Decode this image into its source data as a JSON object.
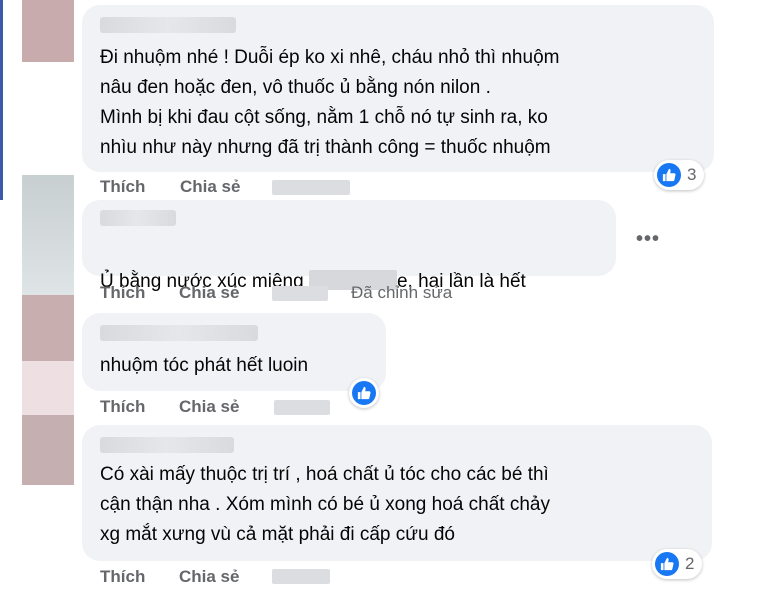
{
  "comments": [
    {
      "text": "Đi nhuộm nhé ! Duỗi ép ko xi nhê, cháu nhỏ thì nhuộm\nnâu đen hoặc đen, vô thuốc ủ bằng nón nilon .\nMình bị khi đau cột sống, nằm 1 chỗ nó tự sinh ra, ko\nnhìu như này nhưng đã trị thành công = thuốc nhuộm",
      "like": "Thích",
      "share": "Chia sẻ",
      "reaction_count": "3"
    },
    {
      "text_before": "Ủ bằng nước xúc miệng ",
      "text_after": "e, hai lần là hết",
      "like": "Thích",
      "share": "Chia sẻ",
      "edited": "Đã chỉnh sửa",
      "more": "•••"
    },
    {
      "text": "nhuộm tóc phát hết luoin",
      "like": "Thích",
      "share": "Chia sẻ"
    },
    {
      "text": "Có xài mấy thuộc trị trí , hoá chất ủ tóc cho các bé thì\ncận thận nha . Xóm mình có bé ủ xong hoá chất chảy\nxg mắt xưng vù cả mặt phải đi cấp cứu đó",
      "like": "Thích",
      "share": "Chia sẻ",
      "reaction_count": "2"
    }
  ],
  "icons": {
    "like": "like-thumb-icon",
    "more": "more-horizontal-icon"
  },
  "colors": {
    "bubble": "#f0f2f5",
    "like_blue": "#1877f2",
    "meta_gray": "#65676b"
  }
}
